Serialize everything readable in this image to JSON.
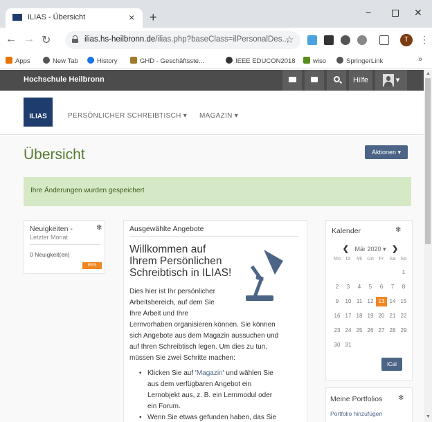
{
  "browser": {
    "tab_title": "ILIAS - Übersicht",
    "tab_close": "×",
    "new_tab": "+",
    "url_host": "ilias.hs-heilbronn.de",
    "url_path": "/ilias.php?baseClass=ilPersonalDes...",
    "window_min": "−",
    "window_close": "✕",
    "profile_initial": "T"
  },
  "bookmarks": [
    {
      "label": "Apps",
      "color": "#e37400"
    },
    {
      "label": "New Tab",
      "color": "#555"
    },
    {
      "label": "History",
      "color": "#1a73e8"
    },
    {
      "label": "GHD - Geschäftsste...",
      "color": "#a07a2a"
    },
    {
      "label": "IEEE EDUCON2018",
      "color": "#333"
    },
    {
      "label": "wiso",
      "color": "#5b8c1e"
    },
    {
      "label": "SpringerLink",
      "color": "#555"
    }
  ],
  "topbar": {
    "brand": "Hochschule Heilbronn",
    "help_label": "Hilfe"
  },
  "mainnav": {
    "logo_text": "ILIAS",
    "items": [
      {
        "label": "PERSÖNLICHER SCHREIBTISCH ▾"
      },
      {
        "label": "MAGAZIN ▾"
      }
    ]
  },
  "page": {
    "title": "Übersicht",
    "actions_label": "Aktionen ▾",
    "success_message": "Ihre Änderungen wurden gespeichert"
  },
  "news": {
    "title_line1": "Neuigkeiten -",
    "title_line2": "Letzter Monat",
    "count_text": "0 Neuigkeit(en)",
    "rss_label": "RSS"
  },
  "featured": {
    "header": "Ausgewählte Angebote",
    "welcome_lines": [
      "Willkommen auf",
      "Ihrem Persönlichen",
      "Schreibtisch in ILIAS!"
    ],
    "intro_lines": [
      "Dies hier ist Ihr persönlicher",
      "Arbeitsbereich, auf dem Sie",
      "Ihre Arbeit und Ihre",
      "Lernvorhaben organisieren können. Sie können",
      "sich Angebote aus dem Magazin aussuchen und",
      "auf Ihren Schreibtisch legen. Um dies zu tun,",
      "müssen Sie zwei Schritte machen:"
    ],
    "bullet1_prefix": "Klicken Sie auf '",
    "bullet1_link": "Magazin",
    "bullet1_suffix": "' und wählen Sie",
    "bullet1_lines": [
      "aus dem verfügbaren Angebot ein",
      "Lernobjekt aus, z. B. ein Lernmodul oder",
      "ein Forum."
    ],
    "bullet2_line": "Wenn Sie etwas gefunden haben, das Sie"
  },
  "calendar": {
    "title": "Kalender",
    "prev": "❮",
    "month": "Mär 2020 ▾",
    "next": "❯",
    "weekdays": [
      "Mo",
      "Di",
      "Mi",
      "Do",
      "Fr",
      "Sa",
      "So"
    ],
    "weeks": [
      [
        "",
        "",
        "",
        "",
        "",
        "",
        "1"
      ],
      [
        "2",
        "3",
        "4",
        "5",
        "6",
        "7",
        "8"
      ],
      [
        "9",
        "10",
        "11",
        "12",
        "13",
        "14",
        "15"
      ],
      [
        "16",
        "17",
        "18",
        "19",
        "20",
        "21",
        "22"
      ],
      [
        "23",
        "24",
        "25",
        "26",
        "27",
        "28",
        "29"
      ],
      [
        "30",
        "31",
        "",
        "",
        "",
        "",
        ""
      ]
    ],
    "today": "13",
    "ical_label": "iCal"
  },
  "portfolio": {
    "title": "Meine Portfolios",
    "add_label": "Portfolio hinzufügen"
  },
  "colors": {
    "ilias_blue": "#1f3c6e",
    "button_blue": "#4c6586",
    "title_green": "#557b2e",
    "alert_green": "#d6e9c6",
    "today_orange": "#f08522",
    "topbar": "#4c4c4c"
  }
}
